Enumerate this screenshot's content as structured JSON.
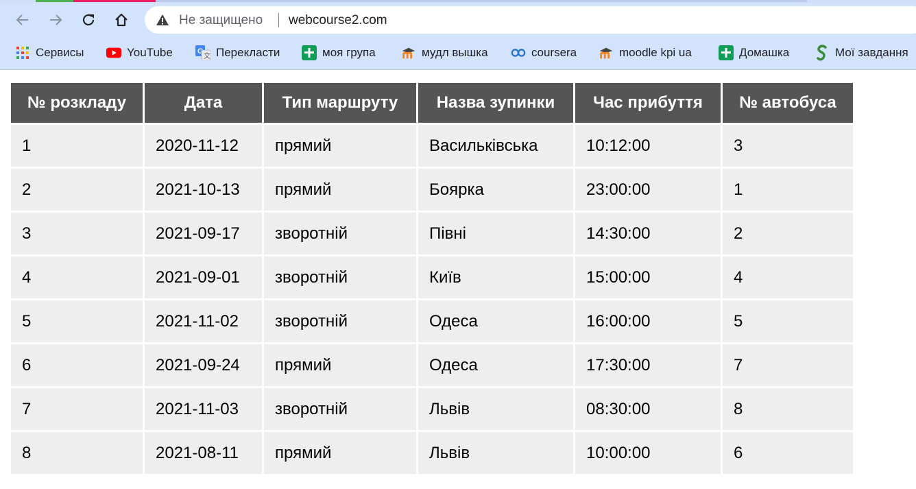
{
  "browser": {
    "insecure_label": "Не защищено",
    "url": "webcourse2.com",
    "bookmarks": [
      {
        "icon": "apps-grid-icon",
        "label": "Сервисы"
      },
      {
        "icon": "youtube-icon",
        "label": "YouTube"
      },
      {
        "icon": "google-translate-icon",
        "label": "Перекласти"
      },
      {
        "icon": "google-classroom-icon",
        "label": "моя група"
      },
      {
        "icon": "moodle-icon",
        "label": "мудл вышка"
      },
      {
        "icon": "coursera-icon",
        "label": "coursera"
      },
      {
        "icon": "moodle-icon",
        "label": "moodle kpi ua"
      },
      {
        "icon": "google-classroom-icon",
        "label": "Домашка"
      },
      {
        "icon": "s-logo-icon",
        "label": "Мої завдання"
      }
    ],
    "colors": {
      "chrome_bg": "#d3e3fd",
      "omnibox_bg": "#ffffff"
    }
  },
  "table": {
    "headers": [
      "№ розкладу",
      "Дата",
      "Тип маршруту",
      "Назва зупинки",
      "Час прибуття",
      "№ автобуса"
    ],
    "rows": [
      [
        "1",
        "2020-11-12",
        "прямий",
        "Васильківська",
        "10:12:00",
        "3"
      ],
      [
        "2",
        "2021-10-13",
        "прямий",
        "Боярка",
        "23:00:00",
        "1"
      ],
      [
        "3",
        "2021-09-17",
        "зворотній",
        "Півні",
        "14:30:00",
        "2"
      ],
      [
        "4",
        "2021-09-01",
        "зворотній",
        "Київ",
        "15:00:00",
        "4"
      ],
      [
        "5",
        "2021-11-02",
        "зворотній",
        "Одеса",
        "16:00:00",
        "5"
      ],
      [
        "6",
        "2021-09-24",
        "прямий",
        "Одеса",
        "17:30:00",
        "7"
      ],
      [
        "7",
        "2021-11-03",
        "зворотній",
        "Львів",
        "08:30:00",
        "8"
      ],
      [
        "8",
        "2021-08-11",
        "прямий",
        "Львів",
        "10:00:00",
        "6"
      ]
    ],
    "colors": {
      "header_bg": "#555555",
      "header_text": "#ffffff",
      "cell_bg": "#eeeeee"
    }
  }
}
